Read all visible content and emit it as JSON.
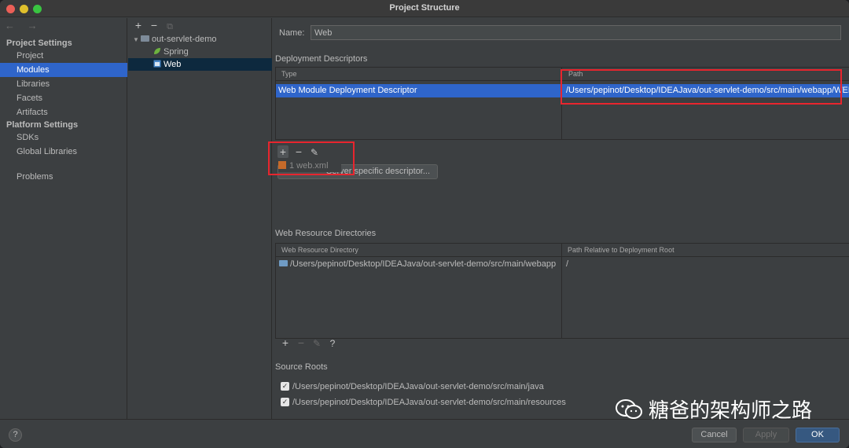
{
  "window": {
    "title": "Project Structure"
  },
  "sidebar": {
    "nav": "← →",
    "project_settings_header": "Project Settings",
    "platform_settings_header": "Platform Settings",
    "items": [
      {
        "label": "Project"
      },
      {
        "label": "Modules"
      },
      {
        "label": "Libraries"
      },
      {
        "label": "Facets"
      },
      {
        "label": "Artifacts"
      },
      {
        "label": "SDKs"
      },
      {
        "label": "Global Libraries"
      },
      {
        "label": "Problems"
      }
    ],
    "selected": "Modules"
  },
  "tree": {
    "toolbar": {
      "add": "+",
      "remove": "−",
      "copy": "⧉"
    },
    "nodes": [
      {
        "label": "out-servlet-demo"
      },
      {
        "label": "Spring"
      },
      {
        "label": "Web"
      }
    ],
    "selected": "Web"
  },
  "main": {
    "name_label": "Name:",
    "name_value": "Web",
    "deployment": {
      "title": "Deployment Descriptors",
      "col_type": "Type",
      "col_path": "Path",
      "row_type": "Web Module Deployment Descriptor",
      "row_path": "/Users/pepinot/Desktop/IDEAJava/out-servlet-demo/src/main/webapp/WEB-",
      "toolbar": {
        "add": "+",
        "remove": "−",
        "edit": "✎"
      },
      "popup_item": "1  web.xml",
      "server_btn": "Add Application Server specific descriptor...",
      "server_btn_visible": "Server specific descriptor..."
    },
    "web_resources": {
      "title": "Web Resource Directories",
      "col_dir": "Web Resource Directory",
      "col_rel": "Path Relative to Deployment Root",
      "row_dir": "/Users/pepinot/Desktop/IDEAJava/out-servlet-demo/src/main/webapp",
      "row_rel": "/",
      "toolbar": {
        "add": "+",
        "remove": "−",
        "edit": "✎",
        "help": "?"
      }
    },
    "source_roots": {
      "title": "Source Roots",
      "items": [
        {
          "path": "/Users/pepinot/Desktop/IDEAJava/out-servlet-demo/src/main/java",
          "checked": true
        },
        {
          "path": "/Users/pepinot/Desktop/IDEAJava/out-servlet-demo/src/main/resources",
          "checked": true
        }
      ]
    }
  },
  "footer": {
    "help": "?",
    "cancel": "Cancel",
    "apply": "Apply",
    "ok": "OK"
  },
  "watermark": {
    "text": "糖爸的架构师之路"
  },
  "colors": {
    "selection": "#2f65ca",
    "highlight": "#e8252e",
    "primary_button": "#365880"
  }
}
